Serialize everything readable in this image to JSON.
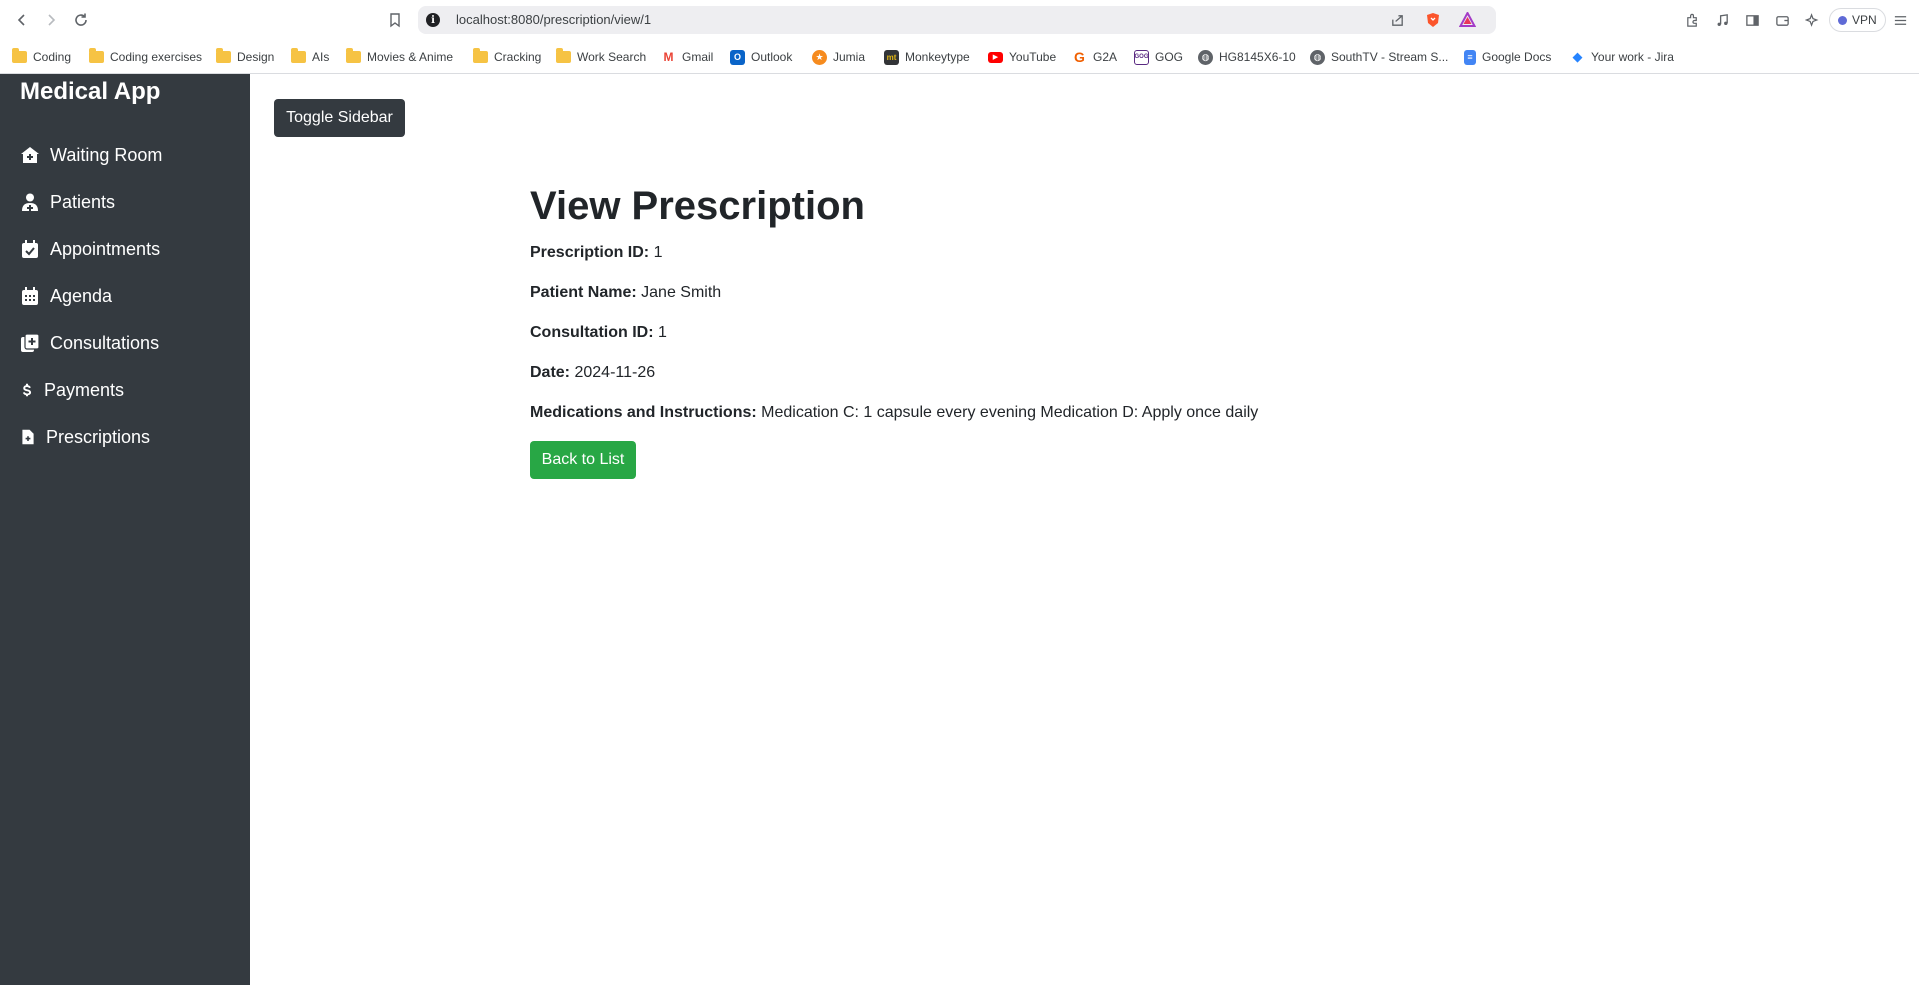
{
  "browser": {
    "url": "localhost:8080/prescription/view/1",
    "vpn_label": "VPN",
    "bookmarks": [
      {
        "label": "Coding",
        "icon": "folder-icon"
      },
      {
        "label": "Coding exercises",
        "icon": "folder-icon"
      },
      {
        "label": "Design",
        "icon": "folder-icon"
      },
      {
        "label": "AIs",
        "icon": "folder-icon"
      },
      {
        "label": "Movies & Anime",
        "icon": "folder-icon"
      },
      {
        "label": "Cracking",
        "icon": "folder-icon"
      },
      {
        "label": "Work Search",
        "icon": "folder-icon"
      },
      {
        "label": "Gmail",
        "icon": "gmail-icon"
      },
      {
        "label": "Outlook",
        "icon": "outlook-icon"
      },
      {
        "label": "Jumia",
        "icon": "jumia-icon"
      },
      {
        "label": "Monkeytype",
        "icon": "monkeytype-icon"
      },
      {
        "label": "YouTube",
        "icon": "youtube-icon"
      },
      {
        "label": "G2A",
        "icon": "g2a-icon"
      },
      {
        "label": "GOG",
        "icon": "gog-icon"
      },
      {
        "label": "HG8145X6-10",
        "icon": "globe-icon"
      },
      {
        "label": "SouthTV - Stream S...",
        "icon": "globe-icon"
      },
      {
        "label": "Google Docs",
        "icon": "google-docs-icon"
      },
      {
        "label": "Your work - Jira",
        "icon": "jira-icon"
      }
    ]
  },
  "sidebar": {
    "brand": "Medical App",
    "items": [
      {
        "label": "Waiting Room",
        "icon": "house-medical-icon"
      },
      {
        "label": "Patients",
        "icon": "user-doctor-icon"
      },
      {
        "label": "Appointments",
        "icon": "calendar-check-icon"
      },
      {
        "label": "Agenda",
        "icon": "calendar-icon"
      },
      {
        "label": "Consultations",
        "icon": "file-plus-icon"
      },
      {
        "label": "Payments",
        "icon": "dollar-icon"
      },
      {
        "label": "Prescriptions",
        "icon": "file-medical-icon"
      }
    ]
  },
  "main": {
    "toggle_label": "Toggle Sidebar",
    "title": "View Prescription",
    "fields": [
      {
        "label": "Prescription ID:",
        "value": "1"
      },
      {
        "label": "Patient Name:",
        "value": "Jane Smith"
      },
      {
        "label": "Consultation ID:",
        "value": "1"
      },
      {
        "label": "Date:",
        "value": "2024-11-26"
      },
      {
        "label": "Medications and Instructions:",
        "value": "Medication C: 1 capsule every evening Medication D: Apply once daily"
      }
    ],
    "back_label": "Back to List"
  },
  "colors": {
    "sidebar_bg": "#343a40",
    "success": "#28a745",
    "text": "#212529"
  }
}
